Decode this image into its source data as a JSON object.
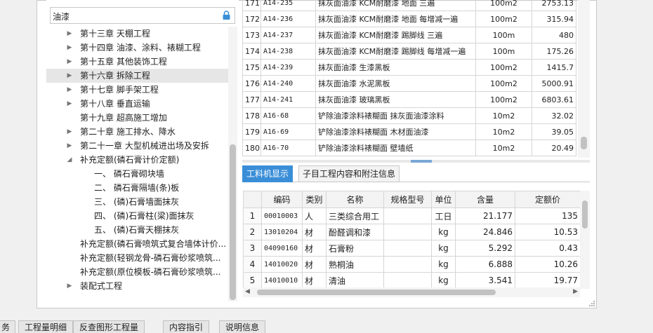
{
  "search": {
    "value": "油漆"
  },
  "tree": [
    {
      "label": "第十三章 天棚工程",
      "arrow": "▶",
      "level": 0
    },
    {
      "label": "第十四章 油漆、涂料、裱糊工程",
      "arrow": "▶",
      "level": 0
    },
    {
      "label": "第十五章 其他装饰工程",
      "arrow": "▶",
      "level": 0
    },
    {
      "label": "第十六章 拆除工程",
      "arrow": "▶",
      "level": 0,
      "selected": true
    },
    {
      "label": "第十七章 脚手架工程",
      "arrow": "▶",
      "level": 0
    },
    {
      "label": "第十八章 垂直运输",
      "arrow": "▶",
      "level": 0
    },
    {
      "label": "第十九章 超高施工增加",
      "arrow": "",
      "level": 0
    },
    {
      "label": "第二十章 施工排水、降水",
      "arrow": "▶",
      "level": 0
    },
    {
      "label": "第二十一章 大型机械进出场及安拆",
      "arrow": "▶",
      "level": 0
    },
    {
      "label": "补充定额(磷石膏计价定额)",
      "arrow": "◢",
      "level": 0
    },
    {
      "label": "一、 磷石膏砌块墙",
      "arrow": "",
      "level": 1
    },
    {
      "label": "二、 磷石膏隔墙(条)板",
      "arrow": "",
      "level": 1
    },
    {
      "label": "三、 (磷)石膏墙面抹灰",
      "arrow": "",
      "level": 1
    },
    {
      "label": "四、 (磷)石膏柱(梁)面抹灰",
      "arrow": "",
      "level": 1
    },
    {
      "label": "五、 (磷)石膏天棚抹灰",
      "arrow": "",
      "level": 1
    },
    {
      "label": "补充定额(磷石膏喷筑式复合墙体计价...",
      "arrow": "",
      "level": 0
    },
    {
      "label": "补充定额(轻钢龙骨-磷石膏砂浆喷筑...",
      "arrow": "",
      "level": 0
    },
    {
      "label": "补充定额(原位模板-磷石膏砂浆喷筑...",
      "arrow": "",
      "level": 0
    },
    {
      "label": "装配式工程",
      "arrow": "▶",
      "level": 0
    }
  ],
  "top_rows": [
    {
      "no": "171",
      "code": "A14-235",
      "name": "抹灰面油漆 KCM耐磨漆 地面 三遍",
      "unit": "100m2",
      "price": "2753.13"
    },
    {
      "no": "172",
      "code": "A14-236",
      "name": "抹灰面油漆 KCM耐磨漆 地面 每增减一遍",
      "unit": "100m2",
      "price": "315.94"
    },
    {
      "no": "173",
      "code": "A14-237",
      "name": "抹灰面油漆 KCM耐磨漆 踢脚线 三遍",
      "unit": "100m",
      "price": "480"
    },
    {
      "no": "174",
      "code": "A14-238",
      "name": "抹灰面油漆 KCM耐磨漆 踢脚线 每增减一遍",
      "unit": "100m",
      "price": "175.26"
    },
    {
      "no": "175",
      "code": "A14-239",
      "name": "抹灰面油漆 生漆黑板",
      "unit": "100m2",
      "price": "1415.7"
    },
    {
      "no": "176",
      "code": "A14-240",
      "name": "抹灰面油漆 水泥黑板",
      "unit": "100m2",
      "price": "5000.91"
    },
    {
      "no": "177",
      "code": "A14-241",
      "name": "抹灰面油漆 玻璃黑板",
      "unit": "100m2",
      "price": "6803.61"
    },
    {
      "no": "178",
      "code": "A16-68",
      "name": "铲除油漆涂料裱糊面 抹灰面油漆涂料",
      "unit": "10m2",
      "price": "32.02"
    },
    {
      "no": "179",
      "code": "A16-69",
      "name": "铲除油漆涂料裱糊面 木材面油漆",
      "unit": "10m2",
      "price": "39.05"
    },
    {
      "no": "180",
      "code": "A16-70",
      "name": "铲除油漆涂料裱糊面 壁墙纸",
      "unit": "10m2",
      "price": "20.49"
    }
  ],
  "tabs": [
    "工料机显示",
    "子目工程内容和附注信息"
  ],
  "bottom_headers": [
    "",
    "编码",
    "类别",
    "名称",
    "规格型号",
    "单位",
    "含量",
    "定额价"
  ],
  "bottom_rows": [
    {
      "idx": "1",
      "code": "00010003",
      "type": "人",
      "name": "三类综合用工",
      "spec": "",
      "unit": "工日",
      "qty": "21.177",
      "price": "135"
    },
    {
      "idx": "2",
      "code": "13010204",
      "type": "材",
      "name": "酚醛调和漆",
      "spec": "",
      "unit": "kg",
      "qty": "24.846",
      "price": "10.53"
    },
    {
      "idx": "3",
      "code": "04090160",
      "type": "材",
      "name": "石膏粉",
      "spec": "",
      "unit": "kg",
      "qty": "5.292",
      "price": "0.43"
    },
    {
      "idx": "4",
      "code": "14010020",
      "type": "材",
      "name": "熟桐油",
      "spec": "",
      "unit": "kg",
      "qty": "6.888",
      "price": "10.26"
    },
    {
      "idx": "5",
      "code": "14010010",
      "type": "材",
      "name": "清油",
      "spec": "",
      "unit": "kg",
      "qty": "3.541",
      "price": "19.77"
    }
  ],
  "bottom_tabs": [
    "务",
    "工程量明细",
    "反查图形工程量",
    "内容指引",
    "说明信息"
  ],
  "colors": {
    "accent": "#3a8ed8",
    "grid": "#d6d6d6"
  }
}
